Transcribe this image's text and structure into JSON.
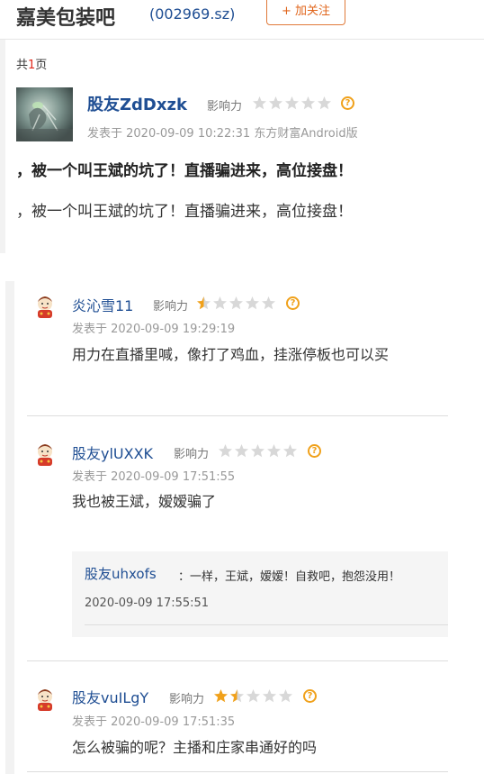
{
  "header": {
    "stock_name": "嘉美包装吧",
    "stock_code": "(002969.sz)",
    "follow_label": "+ 加关注"
  },
  "page_info": {
    "prefix": "共",
    "count": "1",
    "suffix": "页"
  },
  "colors": {
    "link_blue": "#1f4e93",
    "accent_orange": "#e0641a",
    "star_gold": "#f0a11b",
    "page_num_red": "#e0281a"
  },
  "main_post": {
    "username": "股友ZdDxzk",
    "influence_label": "影响力",
    "stars": 0,
    "meta": "发表于 2020-09-09 10:22:31 东方财富Android版",
    "title": "，被一个叫王斌的坑了！直播骗进来，高位接盘！",
    "body": "，被一个叫王斌的坑了！直播骗进来，高位接盘！",
    "help_icon": "question-icon"
  },
  "replies": [
    {
      "username": "炎沁雪11",
      "influence_label": "影响力",
      "stars": 0.5,
      "meta": "发表于 2020-09-09 19:29:19",
      "text": "用力在直播里喊，像打了鸡血，挂涨停板也可以买"
    },
    {
      "username": "股友ylUXXK",
      "influence_label": "影响力",
      "stars": 0,
      "meta": "发表于 2020-09-09 17:51:55",
      "text": "我也被王斌，嫒嫒骗了",
      "subreply": {
        "username": "股友uhxofs",
        "text": "：一样，王斌，嫒嫒！自救吧，抱怨没用！",
        "time": "2020-09-09 17:55:51"
      }
    },
    {
      "username": "股友vuILgY",
      "influence_label": "影响力",
      "stars": 1.5,
      "meta": "发表于 2020-09-09 17:51:35",
      "text": "怎么被骗的呢？主播和庄家串通好的吗"
    }
  ]
}
